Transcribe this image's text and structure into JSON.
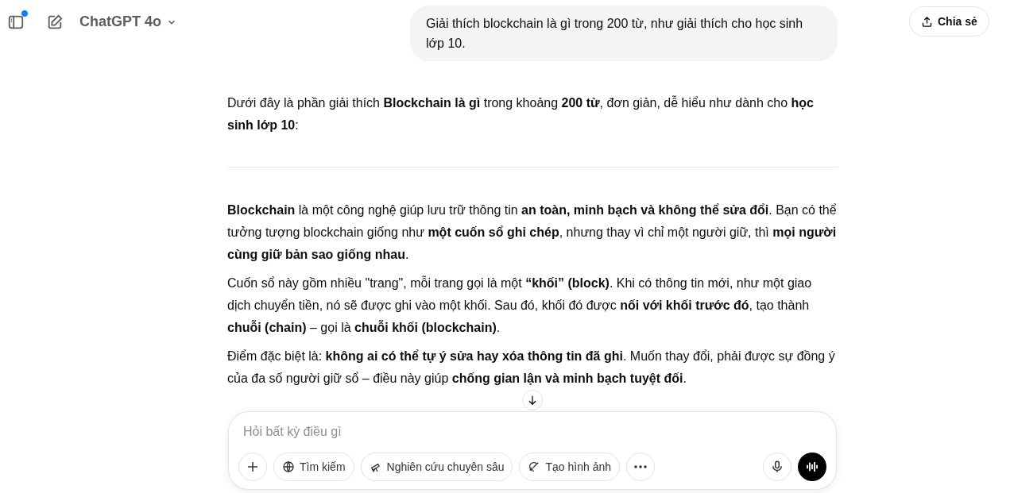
{
  "header": {
    "model": "ChatGPT 4o",
    "notification_dot": true,
    "share_label": "Chia sẻ"
  },
  "user_message": "Giải thích blockchain là gì trong 200 từ, như giải thích cho học sinh lớp 10.",
  "response": {
    "intro": "Dưới đây là phần giải thích **Blockchain là gì** trong khoảng **200 từ**, đơn giản, dễ hiểu như dành cho **học sinh lớp 10**:",
    "paragraphs": [
      "**Blockchain** là một công nghệ giúp lưu trữ thông tin **an toàn, minh bạch và không thể sửa đổi**. Bạn có thể tưởng tượng blockchain giống như **một cuốn sổ ghi chép**, nhưng thay vì chỉ một người giữ, thì **mọi người cùng giữ bản sao giống nhau**.",
      "Cuốn sổ này gồm nhiều \"trang\", mỗi trang gọi là một **“khối” (block)**. Khi có thông tin mới, như một giao dịch chuyển tiền, nó sẽ được ghi vào một khối. Sau đó, khối đó được **nối với khối trước đó**, tạo thành **chuỗi (chain)** – gọi là **chuỗi khối (blockchain)**.",
      "Điểm đặc biệt là: **không ai có thể tự ý sửa hay xóa thông tin đã ghi**. Muốn thay đổi, phải được sự đồng ý của đa số người giữ sổ – điều này giúp **chống gian lận và minh bạch tuyệt đối**."
    ]
  },
  "composer": {
    "placeholder": "Hỏi bất kỳ điều gì",
    "tools": [
      {
        "kind": "search",
        "label": "Tìm kiếm"
      },
      {
        "kind": "research",
        "label": "Nghiên cứu chuyên sâu"
      },
      {
        "kind": "image",
        "label": "Tạo hình ảnh"
      }
    ]
  }
}
